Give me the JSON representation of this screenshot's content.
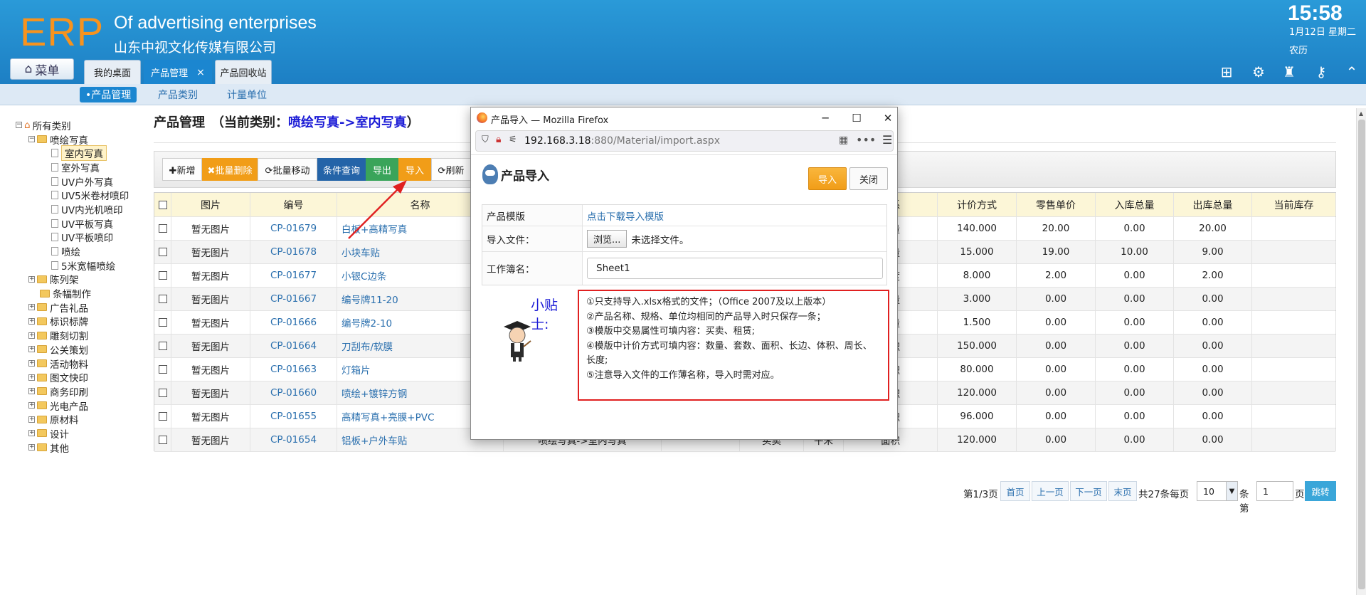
{
  "header": {
    "logo": "ERP",
    "enterprise_en": "Of advertising enterprises",
    "enterprise_cn": "山东中视文化传媒有限公司",
    "time": "15:58",
    "date": "1月12日 星期二",
    "lunar": "农历",
    "menu_label": "菜单"
  },
  "tabs": [
    {
      "label": "我的桌面"
    },
    {
      "label": "产品管理",
      "close": "×"
    },
    {
      "label": "产品回收站"
    }
  ],
  "subnav": [
    "•产品管理",
    "产品类别",
    "计量单位"
  ],
  "tree": {
    "root": "所有类别",
    "group1": "喷绘写真",
    "leaves": [
      "室内写真",
      "室外写真",
      "UV户外写真",
      "UV5米卷材喷印",
      "UV内光机喷印",
      "UV平板写真",
      "UV平板喷印",
      "喷绘",
      "5米宽幅喷绘"
    ],
    "others": [
      "陈列架",
      "条幅制作",
      "广告礼品",
      "标识标牌",
      "雕刻切割",
      "公关策划",
      "活动物料",
      "图文快印",
      "商务印刷",
      "光电产品",
      "原材料",
      "设计",
      "其他"
    ]
  },
  "page_title": {
    "prefix": "产品管理　（当前类别：",
    "category": "喷绘写真->室内写真",
    "suffix": "）"
  },
  "toolbar": {
    "add": "✚新增",
    "batch_delete": "✖批量删除",
    "batch_move": "⟳批量移动",
    "query": "条件查询",
    "export": "导出",
    "import": "导入",
    "refresh": "⟳刷新"
  },
  "table": {
    "headers": [
      "图片",
      "编号",
      "名称",
      "",
      "",
      "",
      "",
      "关系",
      "计价方式",
      "零售单价",
      "入库总量",
      "出库总量",
      "当前库存"
    ],
    "rows": [
      [
        "暂无图片",
        "CP-01679",
        "白板+高精写真",
        "数量",
        "140.000",
        "20.00",
        "0.00",
        "20.00"
      ],
      [
        "暂无图片",
        "CP-01678",
        "小块车贴",
        "数量",
        "15.000",
        "19.00",
        "10.00",
        "9.00"
      ],
      [
        "暂无图片",
        "CP-01677",
        "小银C边条",
        "长度",
        "8.000",
        "2.00",
        "0.00",
        "2.00"
      ],
      [
        "暂无图片",
        "CP-01667",
        "编号牌11-20",
        "数量",
        "3.000",
        "0.00",
        "0.00",
        "0.00"
      ],
      [
        "暂无图片",
        "CP-01666",
        "编号牌2-10",
        "数量",
        "1.500",
        "0.00",
        "0.00",
        "0.00"
      ],
      [
        "暂无图片",
        "CP-01664",
        "刀刮布/软膜",
        "面积",
        "150.000",
        "0.00",
        "0.00",
        "0.00"
      ],
      [
        "暂无图片",
        "CP-01663",
        "灯箱片",
        "面积",
        "80.000",
        "0.00",
        "0.00",
        "0.00"
      ],
      [
        "暂无图片",
        "CP-01660",
        "喷绘+镀锌方钢",
        "面积",
        "120.000",
        "0.00",
        "0.00",
        "0.00"
      ],
      [
        "暂无图片",
        "CP-01655",
        "高精写真+亮膜+PVC",
        "面积",
        "96.000",
        "0.00",
        "0.00",
        "0.00"
      ],
      [
        "暂无图片",
        "CP-01654",
        "铝板+户外车贴",
        "面积",
        "120.000",
        "0.00",
        "0.00",
        "0.00"
      ]
    ],
    "partial_last": [
      "喷绘写真->室内写真",
      "买卖",
      "平米"
    ]
  },
  "pager": {
    "page_info": "第1/3页",
    "first": "首页",
    "prev": "上一页",
    "next": "下一页",
    "last": "末页",
    "total": "共27条每页",
    "page_size": "10",
    "goto_prefix": "条第",
    "goto_value": "1",
    "goto_suffix": "页",
    "go": "跳转"
  },
  "dialog": {
    "window_title": "产品导入 — Mozilla Firefox",
    "url_host": "192.168.3.18",
    "url_rest": ":880/Material/import.aspx",
    "heading": "产品导入",
    "import_btn": "导入",
    "close_btn": "关闭",
    "template_label": "产品模版",
    "template_link": "点击下载导入模版",
    "file_label": "导入文件：",
    "browse": "浏览...",
    "no_file": "未选择文件。",
    "sheet_label": "工作簿名：",
    "sheet_value": "Sheet1",
    "tip_label": "小贴士:",
    "tips": [
      "①只支持导入.xlsx格式的文件；（Office 2007及以上版本）",
      "②产品名称、规格、单位均相同的产品导入时只保存一条；",
      "③模版中交易属性可填内容：买卖、租赁;",
      "④模版中计价方式可填内容：数量、套数、面积、长边、体积、周长、长度;",
      "⑤注意导入文件的工作薄名称，导入时需对应。"
    ]
  },
  "colors": {
    "header_blue": "#1d7fc4",
    "accent_orange": "#f19d18",
    "title_blue": "#1b1bd6",
    "annotation_red": "#e02020"
  }
}
